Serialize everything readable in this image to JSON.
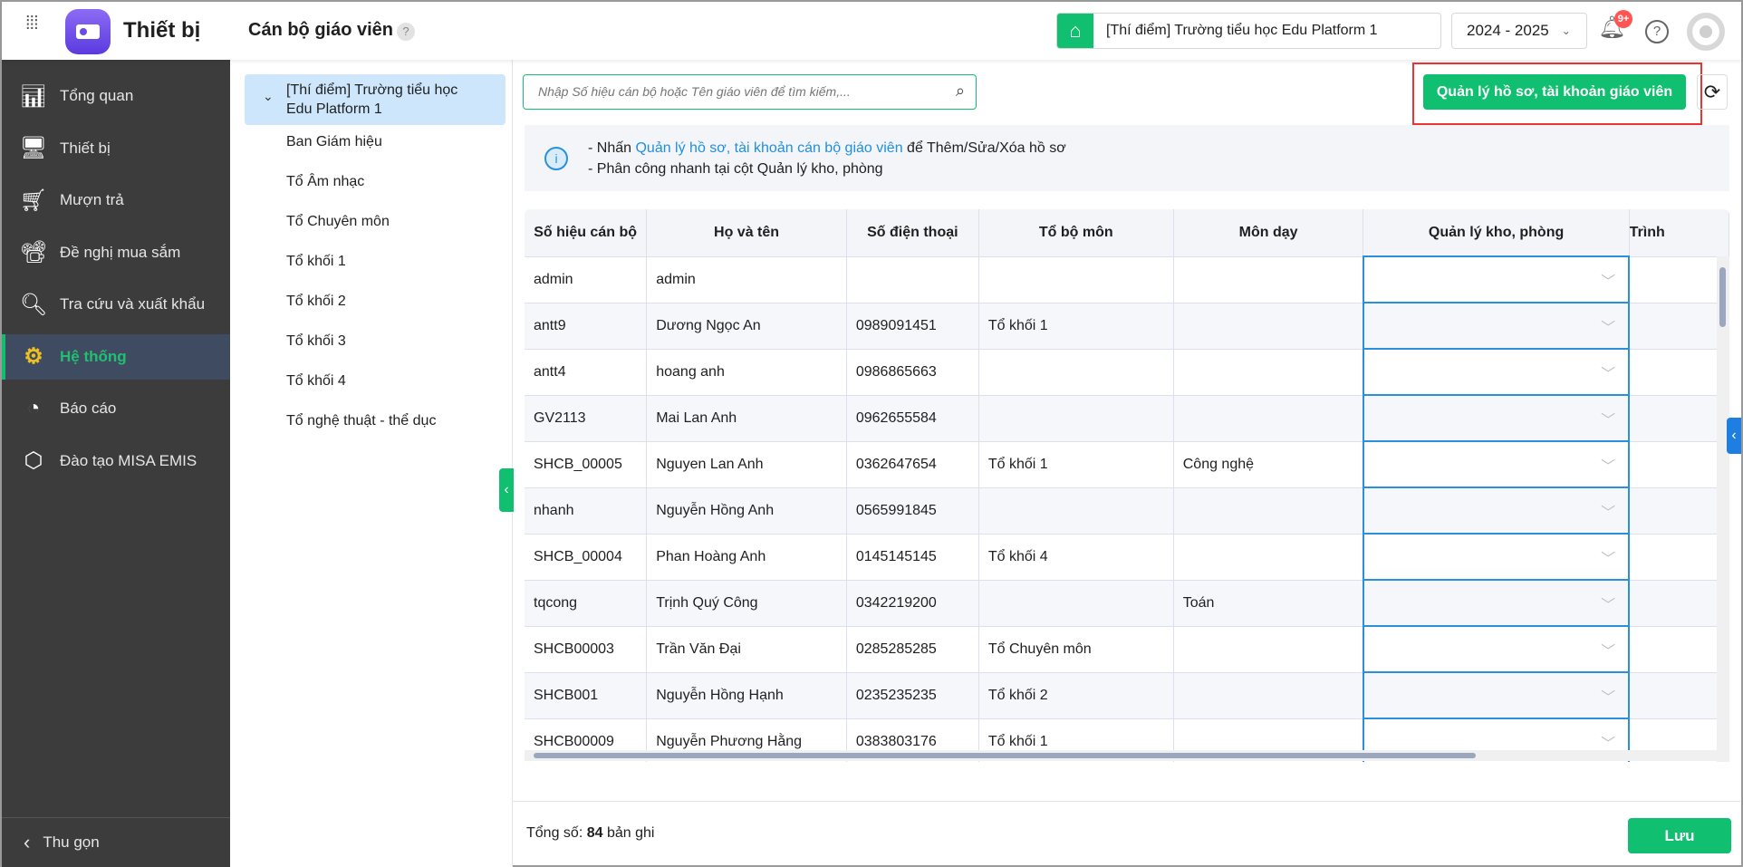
{
  "header": {
    "app_title": "Thiết bị",
    "page_title": "Cán bộ giáo viên",
    "help": "?",
    "school": "[Thí điểm] Trường tiểu học Edu Platform 1",
    "year": "2024 - 2025",
    "notif_badge": "9+",
    "help_icon": "?"
  },
  "sidebar": {
    "items": [
      {
        "label": "Tổng quan",
        "icon": "chart-icon"
      },
      {
        "label": "Thiết bị",
        "icon": "monitor-icon"
      },
      {
        "label": "Mượn trả",
        "icon": "cart-icon"
      },
      {
        "label": "Đề nghị mua sắm",
        "icon": "projector-icon"
      },
      {
        "label": "Tra cứu và xuất khẩu",
        "icon": "search-icon"
      },
      {
        "label": "Hệ thống",
        "icon": "gear-icon"
      },
      {
        "label": "Báo cáo",
        "icon": "pie-icon"
      },
      {
        "label": "Đào tạo MISA EMIS",
        "icon": "cube-icon"
      }
    ],
    "collapse": "Thu gọn"
  },
  "tree": {
    "root": "[Thí điểm] Trường tiểu học Edu Platform 1",
    "items": [
      "Ban Giám hiệu",
      "Tổ Âm nhạc",
      "Tổ Chuyên môn",
      "Tổ khối 1",
      "Tổ khối 2",
      "Tổ khối 3",
      "Tổ khối 4",
      "Tổ nghệ thuật - thể dục"
    ]
  },
  "search": {
    "placeholder": "Nhập Số hiệu cán bộ hoặc Tên giáo viên để tìm kiếm,..."
  },
  "toolbar": {
    "manage_label": "Quản lý hồ sơ, tài khoản giáo viên"
  },
  "info": {
    "line1_prefix": "- Nhấn ",
    "line1_link": "Quản lý hồ sơ, tài khoản cán bộ giáo viên",
    "line1_suffix": " để Thêm/Sửa/Xóa hồ sơ",
    "line2": "- Phân công nhanh tại cột Quản lý kho, phòng"
  },
  "table": {
    "columns": [
      "Số hiệu cán bộ",
      "Họ và tên",
      "Số điện thoại",
      "Tổ bộ môn",
      "Môn dạy",
      "Quản lý kho, phòng",
      "Trình"
    ],
    "rows": [
      [
        "admin",
        "admin",
        "",
        "",
        ""
      ],
      [
        "antt9",
        "Dương Ngọc An",
        "0989091451",
        "Tổ khối 1",
        ""
      ],
      [
        "antt4",
        "hoang anh",
        "0986865663",
        "",
        ""
      ],
      [
        "GV2113",
        "Mai Lan Anh",
        "0962655584",
        "",
        ""
      ],
      [
        "SHCB_00005",
        "Nguyen Lan Anh",
        "0362647654",
        "Tổ khối 1",
        "Công nghệ"
      ],
      [
        "nhanh",
        "Nguyễn Hồng Anh",
        "0565991845",
        "",
        ""
      ],
      [
        "SHCB_00004",
        "Phan Hoàng Anh",
        "0145145145",
        "Tổ khối 4",
        ""
      ],
      [
        "tqcong",
        "Trịnh Quý Công",
        "0342219200",
        "",
        "Toán"
      ],
      [
        "SHCB00003",
        "Trần Văn Đại",
        "0285285285",
        "Tổ Chuyên môn",
        ""
      ],
      [
        "SHCB001",
        "Nguyễn Hồng Hạnh",
        "0235235235",
        "Tổ khối 2",
        ""
      ],
      [
        "SHCB00009",
        "Nguyễn Phương Hằng",
        "0383803176",
        "Tổ khối 1",
        ""
      ]
    ]
  },
  "footer": {
    "total_label": "Tổng số:",
    "total": "84",
    "unit": "bản ghi",
    "save": "Lưu"
  },
  "colors": {
    "accent": "#10bf6f",
    "link": "#1f8fe0",
    "sidebar": "#3c3c3c"
  }
}
